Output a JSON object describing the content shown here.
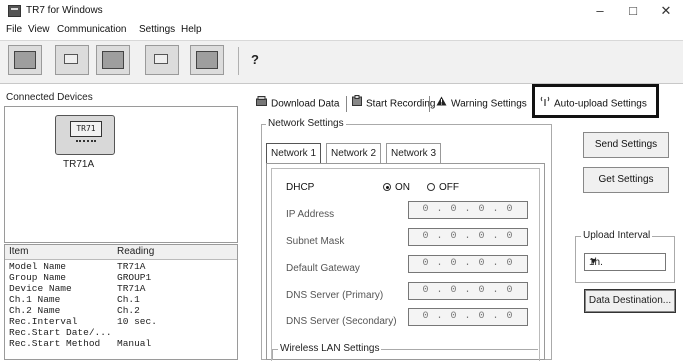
{
  "window": {
    "title": "TR7 for Windows",
    "minimize": "–",
    "maximize": "□",
    "close": "✕"
  },
  "menu": [
    "File",
    "View",
    "Communication",
    "Settings",
    "Help"
  ],
  "toolbar": {
    "help_glyph": "?"
  },
  "left": {
    "connected_label": "Connected Devices",
    "device": {
      "screen": "TR71",
      "name": "TR71A"
    },
    "table": {
      "headers": [
        "Item",
        "Reading"
      ],
      "rows": [
        [
          "Model Name",
          "TR71A"
        ],
        [
          "Group Name",
          "GROUP1"
        ],
        [
          "Device Name",
          "TR71A"
        ],
        [
          "Ch.1 Name",
          "Ch.1"
        ],
        [
          "Ch.2 Name",
          "Ch.2"
        ],
        [
          "Rec.Interval",
          "10 sec."
        ],
        [
          "Rec.Start Date/...",
          ""
        ],
        [
          "Rec.Start Method",
          "Manual"
        ]
      ]
    }
  },
  "tabs": [
    "Download Data",
    "Start Recording",
    "Warning Settings",
    "Auto-upload Settings"
  ],
  "network": {
    "group_label": "Network Settings",
    "tabs": [
      "Network 1",
      "Network 2",
      "Network 3"
    ],
    "dhcp_label": "DHCP",
    "dhcp_on": "ON",
    "dhcp_off": "OFF",
    "fields": [
      {
        "label": "IP Address",
        "value": "0 . 0 . 0 . 0"
      },
      {
        "label": "Subnet Mask",
        "value": "0 . 0 . 0 . 0"
      },
      {
        "label": "Default Gateway",
        "value": "0 . 0 . 0 . 0"
      },
      {
        "label": "DNS Server (Primary)",
        "value": "0 . 0 . 0 . 0"
      },
      {
        "label": "DNS Server (Secondary)",
        "value": "0 . 0 . 0 . 0"
      }
    ],
    "wlan_label": "Wireless LAN Settings"
  },
  "actions": {
    "send": "Send Settings",
    "get": "Get Settings",
    "upload_interval_label": "Upload Interval",
    "upload_interval_value": "1h.",
    "data_destination": "Data Destination..."
  }
}
